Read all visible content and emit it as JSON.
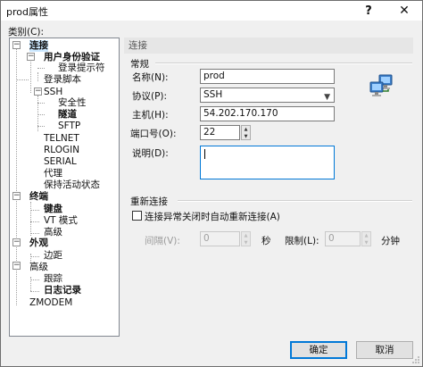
{
  "window": {
    "title": "prod属性",
    "help_glyph": "?",
    "close_glyph": "✕"
  },
  "category": {
    "label": "类别(C):",
    "tree": [
      {
        "label": "连接",
        "bold": true
      },
      {
        "label": "用户身份验证",
        "bold": true
      },
      {
        "label": "登录提示符"
      },
      {
        "label": "登录脚本"
      },
      {
        "label": "SSH"
      },
      {
        "label": "安全性"
      },
      {
        "label": "隧道",
        "bold": true
      },
      {
        "label": "SFTP"
      },
      {
        "label": "TELNET"
      },
      {
        "label": "RLOGIN"
      },
      {
        "label": "SERIAL"
      },
      {
        "label": "代理"
      },
      {
        "label": "保持活动状态"
      },
      {
        "label": "终端",
        "bold": true
      },
      {
        "label": "键盘",
        "bold": true
      },
      {
        "label": "VT 模式"
      },
      {
        "label": "高级"
      },
      {
        "label": "外观",
        "bold": true
      },
      {
        "label": "边距"
      },
      {
        "label": "高级"
      },
      {
        "label": "跟踪"
      },
      {
        "label": "日志记录",
        "bold": true
      },
      {
        "label": "ZMODEM"
      }
    ],
    "toggles": [
      "−",
      "−",
      "−",
      "−",
      "−",
      "−"
    ]
  },
  "panel": {
    "header": "连接",
    "general": {
      "title": "常规",
      "name_label": "名称(N):",
      "name_value": "prod",
      "protocol_label": "协议(P):",
      "protocol_value": "SSH",
      "host_label": "主机(H):",
      "host_value": "54.202.170.170",
      "port_label": "端口号(O):",
      "port_value": "22",
      "desc_label": "说明(D):",
      "desc_value": ""
    },
    "reconnect": {
      "title": "重新连接",
      "checkbox_label": "连接异常关闭时自动重新连接(A)",
      "checked": false,
      "interval_label": "间隔(V):",
      "interval_value": "0",
      "interval_unit": "秒",
      "limit_label": "限制(L):",
      "limit_value": "0",
      "limit_unit": "分钟"
    }
  },
  "buttons": {
    "ok": "确定",
    "cancel": "取消"
  },
  "icons": {
    "network": "network-computers-icon"
  }
}
